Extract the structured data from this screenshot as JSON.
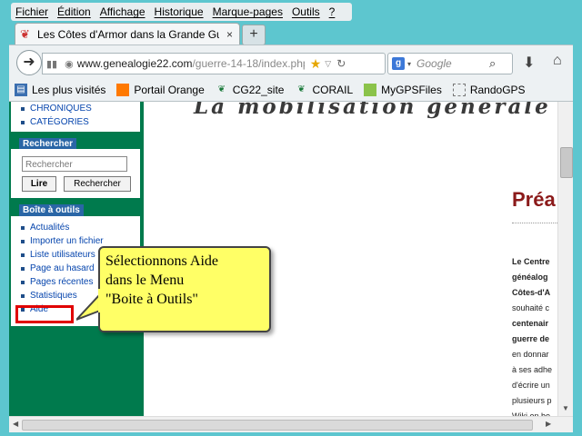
{
  "menu": [
    "Fichier",
    "Édition",
    "Affichage",
    "Historique",
    "Marque-pages",
    "Outils",
    "?"
  ],
  "tab": {
    "title": "Les Côtes d'Armor dans la Grande Guerr...",
    "close": "×",
    "new": "+"
  },
  "url": {
    "domain": "www.genealogie22.com",
    "path": "/guerre-14-18/index.php"
  },
  "search": {
    "placeholder": "Google",
    "engine": "g"
  },
  "bookmarks": [
    "Les plus visités",
    "Portail Orange",
    "CG22_site",
    "CORAIL",
    "MyGPSFiles",
    "RandoGPS"
  ],
  "sidebar": {
    "top_links": [
      "CHRONIQUES",
      "CATÉGORIES"
    ],
    "search_title": "Rechercher",
    "search_placeholder": "Rechercher",
    "btn_go": "Lire",
    "btn_search": "Rechercher",
    "tools_title": "Boîte à outils",
    "tools": [
      "Actualités",
      "Importer un fichier",
      "Liste utilisateurs",
      "Page au hasard",
      "Pages récentes",
      "Statistiques",
      "Aide"
    ]
  },
  "main": {
    "banner": "La mobilisation générale en Fr",
    "heading": "Préa",
    "para": [
      "Le Centre",
      "généalog",
      "Côtes-d'A",
      "souhaité c",
      "centenair",
      "guerre de",
      "en donnar",
      "à ses adhe",
      "d'écrire un",
      "plusieurs p",
      "Wiki en bo"
    ]
  },
  "callout": [
    "Sélectionnons Aide",
    "dans le Menu",
    "\"Boite à Outils\""
  ],
  "colors": {
    "sidebar": "#007a4d",
    "heading": "#8b1a1a",
    "callout": "#ffff66",
    "highlight": "#e00000"
  }
}
